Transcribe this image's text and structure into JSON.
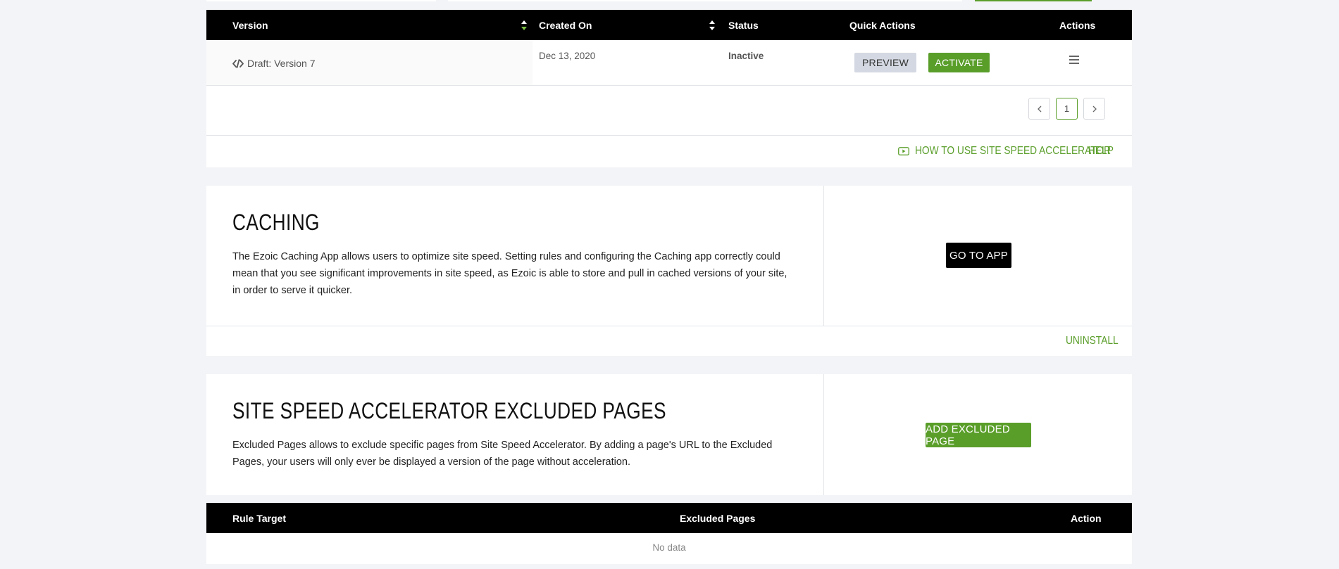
{
  "versions_table": {
    "columns": {
      "version": "Version",
      "created_on": "Created On",
      "status": "Status",
      "quick_actions": "Quick Actions",
      "actions": "Actions"
    },
    "rows": [
      {
        "version": "Draft: Version 7",
        "created_on": "Dec 13, 2020",
        "status": "Inactive",
        "preview_label": "PREVIEW",
        "activate_label": "ACTIVATE"
      }
    ],
    "pagination": {
      "current_page": "1",
      "prev": "<",
      "next": ">"
    }
  },
  "footer_links": {
    "how_to": "HOW TO USE SITE SPEED ACCELERATOR",
    "help": "HELP"
  },
  "caching": {
    "title": "CACHING",
    "description": "The Ezoic Caching App allows users to optimize site speed. Setting rules and configuring the Caching app correctly could mean that you see significant improvements in site speed, as Ezoic is able to store and pull in cached versions of your site, in order to serve it quicker.",
    "go_to_app_label": "GO TO APP",
    "uninstall_label": "UNINSTALL"
  },
  "excluded_pages": {
    "title": "SITE SPEED ACCELERATOR EXCLUDED PAGES",
    "description": "Excluded Pages allows to exclude specific pages from Site Speed Accelerator. By adding a page's URL to the Excluded Pages, your users will only ever be displayed a version of the page without acceleration.",
    "add_label": "ADD EXCLUDED PAGE",
    "table": {
      "columns": {
        "rule_target": "Rule Target",
        "excluded_pages": "Excluded Pages",
        "action": "Action"
      },
      "empty_text": "No data"
    }
  },
  "colors": {
    "accent_green": "#5a9e2a",
    "header_black": "#000000",
    "page_bg": "#f3f4f7",
    "preview_bg": "#d4d8e2"
  }
}
